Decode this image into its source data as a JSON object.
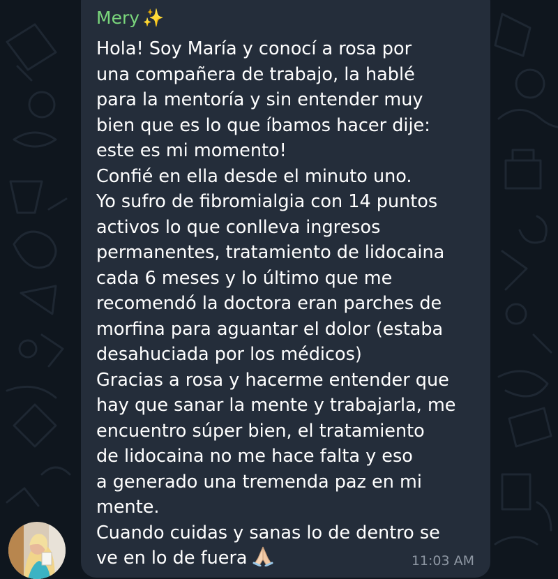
{
  "chat": {
    "sender_name": "Mery",
    "sender_emoji": "✨",
    "message_lines": [
      "Hola! Soy María y conocí a rosa por",
      "una compañera de trabajo, la hablé",
      "para la mentoría y sin entender muy",
      "bien que es lo que íbamos hacer dije:",
      "este es mi momento!",
      "Confié en ella desde el minuto uno.",
      "Yo sufro de fibromialgia con 14 puntos",
      "activos lo que conlleva ingresos",
      "permanentes, tratamiento de lidocaina",
      "cada 6 meses y lo último que me",
      "recomendó la doctora eran parches de",
      "morfina para aguantar el dolor (estaba",
      "desahuciada por los médicos)",
      "Gracias a rosa y hacerme entender que",
      "hay que sanar la mente y trabajarla, me",
      "encuentro súper bien, el tratamiento",
      "de lidocaina no me hace falta y eso",
      "a generado una tremenda paz en mi",
      "mente.",
      "Cuando cuidas y sanas lo de dentro se",
      "ve en lo de fuera"
    ],
    "end_emoji": "folded-hands-emoji",
    "timestamp": "11:03 AM",
    "colors": {
      "background": "#0f161e",
      "bubble": "#242d3a",
      "sender_name": "#7ad67c",
      "message_text": "#ffffff",
      "timestamp": "#8e97a3"
    }
  }
}
